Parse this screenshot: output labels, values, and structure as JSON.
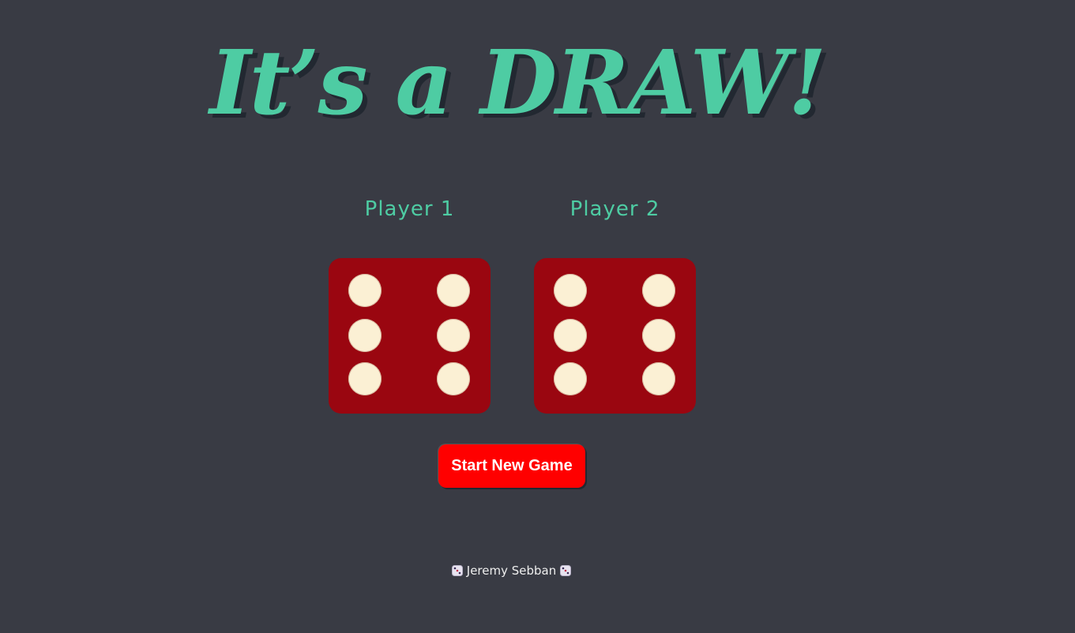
{
  "title": "It’s a DRAW!",
  "players": [
    {
      "label": "Player 1",
      "die_value": 6
    },
    {
      "label": "Player 2",
      "die_value": 6
    }
  ],
  "colors": {
    "background": "#393b44",
    "accent": "#4ecca3",
    "die_face": "#9a0610",
    "pip": "#fbf0d4",
    "button": "#ff0000"
  },
  "button": {
    "label": "Start New Game"
  },
  "footer": {
    "text": "Jeremy Sebban",
    "icon": "die-icon"
  }
}
